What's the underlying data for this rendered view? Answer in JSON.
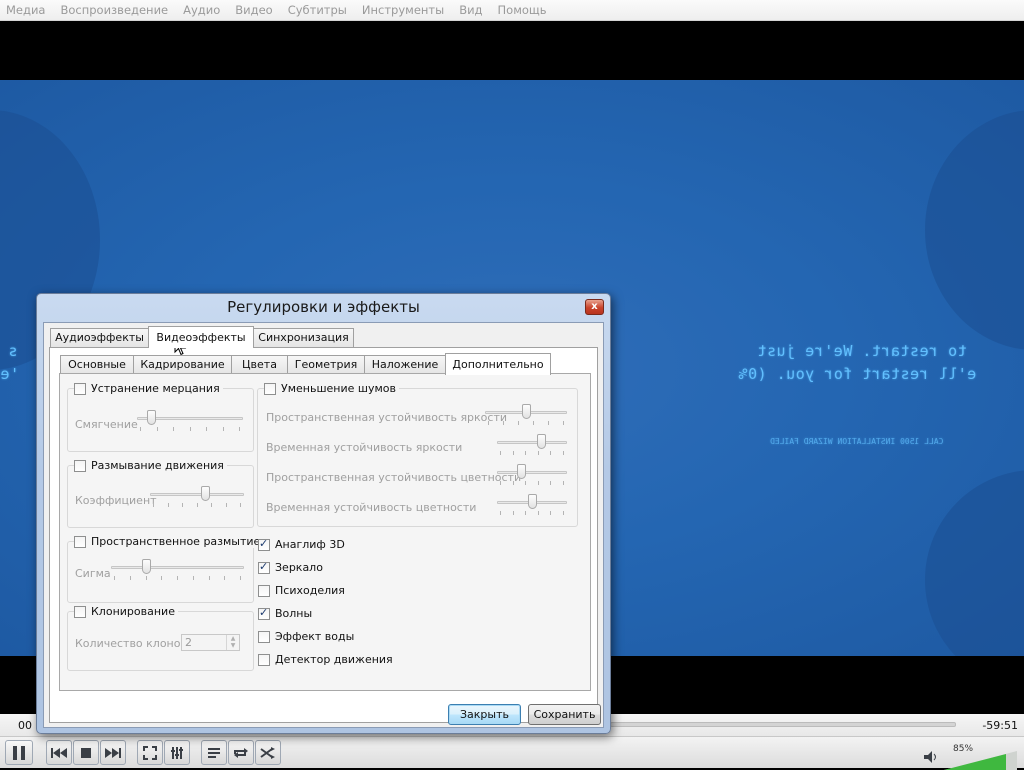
{
  "menu": [
    "Медиа",
    "Воспроизведение",
    "Аудио",
    "Видео",
    "Субтитры",
    "Инструменты",
    "Вид",
    "Помощь"
  ],
  "video": {
    "caption_line1": "to restart. We're just",
    "caption_line2": "e'll restart for you. (0%",
    "caption_left1": "s",
    "caption_left2": "'e",
    "caption_small": "CALL 1500 INSTALLATION WIZARD FAILED"
  },
  "dialog": {
    "title": "Регулировки и эффекты",
    "close_glyph": "x",
    "tabs": [
      "Аудиоэффекты",
      "Видеоэффекты",
      "Синхронизация"
    ],
    "active_tab": "Видеоэффекты",
    "subtabs": [
      "Основные",
      "Кадрирование",
      "Цвета",
      "Геометрия",
      "Наложение",
      "Дополнительно"
    ],
    "active_subtab": "Дополнительно",
    "flicker": {
      "label": "Устранение мерцания",
      "checked": false,
      "slider_label": "Смягчение",
      "value_fraction": 0.1
    },
    "motion_blur": {
      "label": "Размывание движения",
      "checked": false,
      "slider_label": "Коэффициент",
      "value_fraction": 0.6
    },
    "spatial_blur": {
      "label": "Пространственное размытие",
      "checked": false,
      "slider_label": "Сигма",
      "value_fraction": 0.25
    },
    "clone": {
      "label": "Клонирование",
      "checked": false,
      "count_label": "Количество клонов",
      "count_value": "2"
    },
    "denoise": {
      "label": "Уменьшение шумов",
      "checked": false,
      "sliders": [
        {
          "label": "Пространственная устойчивость яркости",
          "value_fraction": 0.5
        },
        {
          "label": "Временная устойчивость яркости",
          "value_fraction": 0.65
        },
        {
          "label": "Пространственная устойчивость цветности",
          "value_fraction": 0.33
        },
        {
          "label": "Временная устойчивость цветности",
          "value_fraction": 0.5
        }
      ]
    },
    "effects": [
      {
        "label": "Анаглиф 3D",
        "checked": true
      },
      {
        "label": "Зеркало",
        "checked": true
      },
      {
        "label": "Психоделия",
        "checked": false
      },
      {
        "label": "Волны",
        "checked": true
      },
      {
        "label": "Эффект воды",
        "checked": false
      },
      {
        "label": "Детектор движения",
        "checked": false
      }
    ],
    "close_button": "Закрыть",
    "save_button": "Сохранить"
  },
  "playback": {
    "elapsed": "00",
    "remaining": "-59:51",
    "volume": "85%",
    "volume_fraction": 0.85
  },
  "colors": {
    "video_bg": "#2466b2",
    "caption": "#62c0ff",
    "volume_fill": "#3fb83f"
  }
}
